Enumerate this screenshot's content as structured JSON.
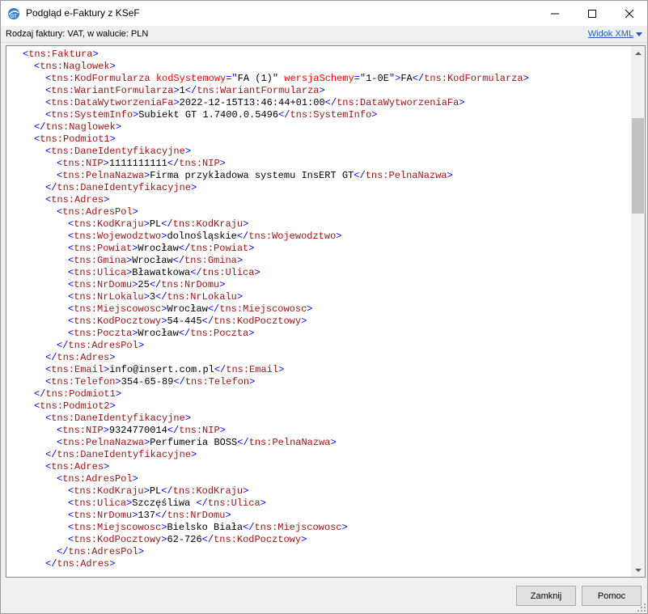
{
  "window": {
    "title": "Podgląd e-Faktury z KSeF",
    "app_icon": "gt-logo-icon",
    "minimize_icon": "minimize-icon",
    "maximize_icon": "maximize-icon",
    "close_icon": "close-icon"
  },
  "infobar": {
    "text": "Rodzaj faktury: VAT, w walucie: PLN",
    "view_link": "Widok XML"
  },
  "xml_lines": [
    {
      "indent": 1,
      "parts": [
        [
          "b",
          "<"
        ],
        [
          "t",
          "tns:Faktura"
        ],
        [
          "b",
          ">"
        ]
      ]
    },
    {
      "indent": 2,
      "parts": [
        [
          "b",
          "<"
        ],
        [
          "t",
          "tns:Naglowek"
        ],
        [
          "b",
          ">"
        ]
      ]
    },
    {
      "indent": 3,
      "parts": [
        [
          "b",
          "<"
        ],
        [
          "t",
          "tns:KodFormularza"
        ],
        [
          "x",
          " "
        ],
        [
          "a",
          "kodSystemowy"
        ],
        [
          "b",
          "=\""
        ],
        [
          "x",
          "FA (1)"
        ],
        [
          "b",
          "\""
        ],
        [
          "x",
          " "
        ],
        [
          "a",
          "wersjaSchemy"
        ],
        [
          "b",
          "=\""
        ],
        [
          "x",
          "1-0E"
        ],
        [
          "b",
          "\">"
        ],
        [
          "x",
          "FA"
        ],
        [
          "b",
          "</"
        ],
        [
          "t",
          "tns:KodFormularza"
        ],
        [
          "b",
          ">"
        ]
      ]
    },
    {
      "indent": 3,
      "parts": [
        [
          "b",
          "<"
        ],
        [
          "t",
          "tns:WariantFormularza"
        ],
        [
          "b",
          ">"
        ],
        [
          "x",
          "1"
        ],
        [
          "b",
          "</"
        ],
        [
          "t",
          "tns:WariantFormularza"
        ],
        [
          "b",
          ">"
        ]
      ]
    },
    {
      "indent": 3,
      "parts": [
        [
          "b",
          "<"
        ],
        [
          "t",
          "tns:DataWytworzeniaFa"
        ],
        [
          "b",
          ">"
        ],
        [
          "x",
          "2022-12-15T13:46:44+01:00"
        ],
        [
          "b",
          "</"
        ],
        [
          "t",
          "tns:DataWytworzeniaFa"
        ],
        [
          "b",
          ">"
        ]
      ]
    },
    {
      "indent": 3,
      "parts": [
        [
          "b",
          "<"
        ],
        [
          "t",
          "tns:SystemInfo"
        ],
        [
          "b",
          ">"
        ],
        [
          "x",
          "Subiekt GT 1.7400.0.5496"
        ],
        [
          "b",
          "</"
        ],
        [
          "t",
          "tns:SystemInfo"
        ],
        [
          "b",
          ">"
        ]
      ]
    },
    {
      "indent": 2,
      "parts": [
        [
          "b",
          "</"
        ],
        [
          "t",
          "tns:Naglowek"
        ],
        [
          "b",
          ">"
        ]
      ]
    },
    {
      "indent": 2,
      "parts": [
        [
          "b",
          "<"
        ],
        [
          "t",
          "tns:Podmiot1"
        ],
        [
          "b",
          ">"
        ]
      ]
    },
    {
      "indent": 3,
      "parts": [
        [
          "b",
          "<"
        ],
        [
          "t",
          "tns:DaneIdentyfikacyjne"
        ],
        [
          "b",
          ">"
        ]
      ]
    },
    {
      "indent": 4,
      "parts": [
        [
          "b",
          "<"
        ],
        [
          "t",
          "tns:NIP"
        ],
        [
          "b",
          ">"
        ],
        [
          "x",
          "1111111111"
        ],
        [
          "b",
          "</"
        ],
        [
          "t",
          "tns:NIP"
        ],
        [
          "b",
          ">"
        ]
      ]
    },
    {
      "indent": 4,
      "parts": [
        [
          "b",
          "<"
        ],
        [
          "t",
          "tns:PelnaNazwa"
        ],
        [
          "b",
          ">"
        ],
        [
          "x",
          "Firma przykładowa systemu InsERT GT"
        ],
        [
          "b",
          "</"
        ],
        [
          "t",
          "tns:PelnaNazwa"
        ],
        [
          "b",
          ">"
        ]
      ]
    },
    {
      "indent": 3,
      "parts": [
        [
          "b",
          "</"
        ],
        [
          "t",
          "tns:DaneIdentyfikacyjne"
        ],
        [
          "b",
          ">"
        ]
      ]
    },
    {
      "indent": 3,
      "parts": [
        [
          "b",
          "<"
        ],
        [
          "t",
          "tns:Adres"
        ],
        [
          "b",
          ">"
        ]
      ]
    },
    {
      "indent": 4,
      "parts": [
        [
          "b",
          "<"
        ],
        [
          "t",
          "tns:AdresPol"
        ],
        [
          "b",
          ">"
        ]
      ]
    },
    {
      "indent": 5,
      "parts": [
        [
          "b",
          "<"
        ],
        [
          "t",
          "tns:KodKraju"
        ],
        [
          "b",
          ">"
        ],
        [
          "x",
          "PL"
        ],
        [
          "b",
          "</"
        ],
        [
          "t",
          "tns:KodKraju"
        ],
        [
          "b",
          ">"
        ]
      ]
    },
    {
      "indent": 5,
      "parts": [
        [
          "b",
          "<"
        ],
        [
          "t",
          "tns:Wojewodztwo"
        ],
        [
          "b",
          ">"
        ],
        [
          "x",
          "dolnośląskie"
        ],
        [
          "b",
          "</"
        ],
        [
          "t",
          "tns:Wojewodztwo"
        ],
        [
          "b",
          ">"
        ]
      ]
    },
    {
      "indent": 5,
      "parts": [
        [
          "b",
          "<"
        ],
        [
          "t",
          "tns:Powiat"
        ],
        [
          "b",
          ">"
        ],
        [
          "x",
          "Wrocław"
        ],
        [
          "b",
          "</"
        ],
        [
          "t",
          "tns:Powiat"
        ],
        [
          "b",
          ">"
        ]
      ]
    },
    {
      "indent": 5,
      "parts": [
        [
          "b",
          "<"
        ],
        [
          "t",
          "tns:Gmina"
        ],
        [
          "b",
          ">"
        ],
        [
          "x",
          "Wrocław"
        ],
        [
          "b",
          "</"
        ],
        [
          "t",
          "tns:Gmina"
        ],
        [
          "b",
          ">"
        ]
      ]
    },
    {
      "indent": 5,
      "parts": [
        [
          "b",
          "<"
        ],
        [
          "t",
          "tns:Ulica"
        ],
        [
          "b",
          ">"
        ],
        [
          "x",
          "Bławatkowa"
        ],
        [
          "b",
          "</"
        ],
        [
          "t",
          "tns:Ulica"
        ],
        [
          "b",
          ">"
        ]
      ]
    },
    {
      "indent": 5,
      "parts": [
        [
          "b",
          "<"
        ],
        [
          "t",
          "tns:NrDomu"
        ],
        [
          "b",
          ">"
        ],
        [
          "x",
          "25"
        ],
        [
          "b",
          "</"
        ],
        [
          "t",
          "tns:NrDomu"
        ],
        [
          "b",
          ">"
        ]
      ]
    },
    {
      "indent": 5,
      "parts": [
        [
          "b",
          "<"
        ],
        [
          "t",
          "tns:NrLokalu"
        ],
        [
          "b",
          ">"
        ],
        [
          "x",
          "3"
        ],
        [
          "b",
          "</"
        ],
        [
          "t",
          "tns:NrLokalu"
        ],
        [
          "b",
          ">"
        ]
      ]
    },
    {
      "indent": 5,
      "parts": [
        [
          "b",
          "<"
        ],
        [
          "t",
          "tns:Miejscowosc"
        ],
        [
          "b",
          ">"
        ],
        [
          "x",
          "Wrocław"
        ],
        [
          "b",
          "</"
        ],
        [
          "t",
          "tns:Miejscowosc"
        ],
        [
          "b",
          ">"
        ]
      ]
    },
    {
      "indent": 5,
      "parts": [
        [
          "b",
          "<"
        ],
        [
          "t",
          "tns:KodPocztowy"
        ],
        [
          "b",
          ">"
        ],
        [
          "x",
          "54-445"
        ],
        [
          "b",
          "</"
        ],
        [
          "t",
          "tns:KodPocztowy"
        ],
        [
          "b",
          ">"
        ]
      ]
    },
    {
      "indent": 5,
      "parts": [
        [
          "b",
          "<"
        ],
        [
          "t",
          "tns:Poczta"
        ],
        [
          "b",
          ">"
        ],
        [
          "x",
          "Wrocław"
        ],
        [
          "b",
          "</"
        ],
        [
          "t",
          "tns:Poczta"
        ],
        [
          "b",
          ">"
        ]
      ]
    },
    {
      "indent": 4,
      "parts": [
        [
          "b",
          "</"
        ],
        [
          "t",
          "tns:AdresPol"
        ],
        [
          "b",
          ">"
        ]
      ]
    },
    {
      "indent": 3,
      "parts": [
        [
          "b",
          "</"
        ],
        [
          "t",
          "tns:Adres"
        ],
        [
          "b",
          ">"
        ]
      ]
    },
    {
      "indent": 3,
      "parts": [
        [
          "b",
          "<"
        ],
        [
          "t",
          "tns:Email"
        ],
        [
          "b",
          ">"
        ],
        [
          "x",
          "info@insert.com.pl"
        ],
        [
          "b",
          "</"
        ],
        [
          "t",
          "tns:Email"
        ],
        [
          "b",
          ">"
        ]
      ]
    },
    {
      "indent": 3,
      "parts": [
        [
          "b",
          "<"
        ],
        [
          "t",
          "tns:Telefon"
        ],
        [
          "b",
          ">"
        ],
        [
          "x",
          "354-65-89"
        ],
        [
          "b",
          "</"
        ],
        [
          "t",
          "tns:Telefon"
        ],
        [
          "b",
          ">"
        ]
      ]
    },
    {
      "indent": 2,
      "parts": [
        [
          "b",
          "</"
        ],
        [
          "t",
          "tns:Podmiot1"
        ],
        [
          "b",
          ">"
        ]
      ]
    },
    {
      "indent": 2,
      "parts": [
        [
          "b",
          "<"
        ],
        [
          "t",
          "tns:Podmiot2"
        ],
        [
          "b",
          ">"
        ]
      ]
    },
    {
      "indent": 3,
      "parts": [
        [
          "b",
          "<"
        ],
        [
          "t",
          "tns:DaneIdentyfikacyjne"
        ],
        [
          "b",
          ">"
        ]
      ]
    },
    {
      "indent": 4,
      "parts": [
        [
          "b",
          "<"
        ],
        [
          "t",
          "tns:NIP"
        ],
        [
          "b",
          ">"
        ],
        [
          "x",
          "9324770014"
        ],
        [
          "b",
          "</"
        ],
        [
          "t",
          "tns:NIP"
        ],
        [
          "b",
          ">"
        ]
      ]
    },
    {
      "indent": 4,
      "parts": [
        [
          "b",
          "<"
        ],
        [
          "t",
          "tns:PelnaNazwa"
        ],
        [
          "b",
          ">"
        ],
        [
          "x",
          "Perfumeria BOSS"
        ],
        [
          "b",
          "</"
        ],
        [
          "t",
          "tns:PelnaNazwa"
        ],
        [
          "b",
          ">"
        ]
      ]
    },
    {
      "indent": 3,
      "parts": [
        [
          "b",
          "</"
        ],
        [
          "t",
          "tns:DaneIdentyfikacyjne"
        ],
        [
          "b",
          ">"
        ]
      ]
    },
    {
      "indent": 3,
      "parts": [
        [
          "b",
          "<"
        ],
        [
          "t",
          "tns:Adres"
        ],
        [
          "b",
          ">"
        ]
      ]
    },
    {
      "indent": 4,
      "parts": [
        [
          "b",
          "<"
        ],
        [
          "t",
          "tns:AdresPol"
        ],
        [
          "b",
          ">"
        ]
      ]
    },
    {
      "indent": 5,
      "parts": [
        [
          "b",
          "<"
        ],
        [
          "t",
          "tns:KodKraju"
        ],
        [
          "b",
          ">"
        ],
        [
          "x",
          "PL"
        ],
        [
          "b",
          "</"
        ],
        [
          "t",
          "tns:KodKraju"
        ],
        [
          "b",
          ">"
        ]
      ]
    },
    {
      "indent": 5,
      "parts": [
        [
          "b",
          "<"
        ],
        [
          "t",
          "tns:Ulica"
        ],
        [
          "b",
          ">"
        ],
        [
          "x",
          "Szczęśliwa "
        ],
        [
          "b",
          "</"
        ],
        [
          "t",
          "tns:Ulica"
        ],
        [
          "b",
          ">"
        ]
      ]
    },
    {
      "indent": 5,
      "parts": [
        [
          "b",
          "<"
        ],
        [
          "t",
          "tns:NrDomu"
        ],
        [
          "b",
          ">"
        ],
        [
          "x",
          "137"
        ],
        [
          "b",
          "</"
        ],
        [
          "t",
          "tns:NrDomu"
        ],
        [
          "b",
          ">"
        ]
      ]
    },
    {
      "indent": 5,
      "parts": [
        [
          "b",
          "<"
        ],
        [
          "t",
          "tns:Miejscowosc"
        ],
        [
          "b",
          ">"
        ],
        [
          "x",
          "Bielsko Biała"
        ],
        [
          "b",
          "</"
        ],
        [
          "t",
          "tns:Miejscowosc"
        ],
        [
          "b",
          ">"
        ]
      ]
    },
    {
      "indent": 5,
      "parts": [
        [
          "b",
          "<"
        ],
        [
          "t",
          "tns:KodPocztowy"
        ],
        [
          "b",
          ">"
        ],
        [
          "x",
          "62-726"
        ],
        [
          "b",
          "</"
        ],
        [
          "t",
          "tns:KodPocztowy"
        ],
        [
          "b",
          ">"
        ]
      ]
    },
    {
      "indent": 4,
      "parts": [
        [
          "b",
          "</"
        ],
        [
          "t",
          "tns:AdresPol"
        ],
        [
          "b",
          ">"
        ]
      ]
    },
    {
      "indent": 3,
      "parts": [
        [
          "b",
          "</"
        ],
        [
          "t",
          "tns:Adres"
        ],
        [
          "b",
          ">"
        ]
      ]
    }
  ],
  "buttons": {
    "close_label": "Zamknij",
    "help_label": "Pomoc"
  },
  "colors": {
    "bracket": "#0000ff",
    "tag": "#a31515",
    "attribute": "#ff0000",
    "text": "#000000",
    "link": "#1a5fb4"
  }
}
